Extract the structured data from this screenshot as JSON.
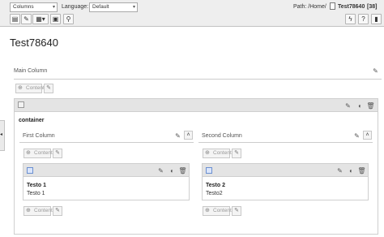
{
  "toolbar": {
    "mode_select": "Columns",
    "language_label": "Language:",
    "language_select": "Default",
    "path_label": "Path: /Home/",
    "page_name": "Test78640",
    "page_id": "[38]"
  },
  "page": {
    "title": "Test78640"
  },
  "main_column": {
    "label": "Main Column",
    "content_button": "Content"
  },
  "container": {
    "title": "container",
    "columns": [
      {
        "label": "First Column",
        "content_button_top": "Content",
        "content_button_bottom": "Content",
        "element": {
          "title": "Testo 1",
          "body": "Testo 1"
        }
      },
      {
        "label": "Second Column",
        "content_button_top": "Content",
        "content_button_bottom": "Content",
        "element": {
          "title": "Testo 2",
          "body": "Testo2"
        }
      }
    ]
  }
}
